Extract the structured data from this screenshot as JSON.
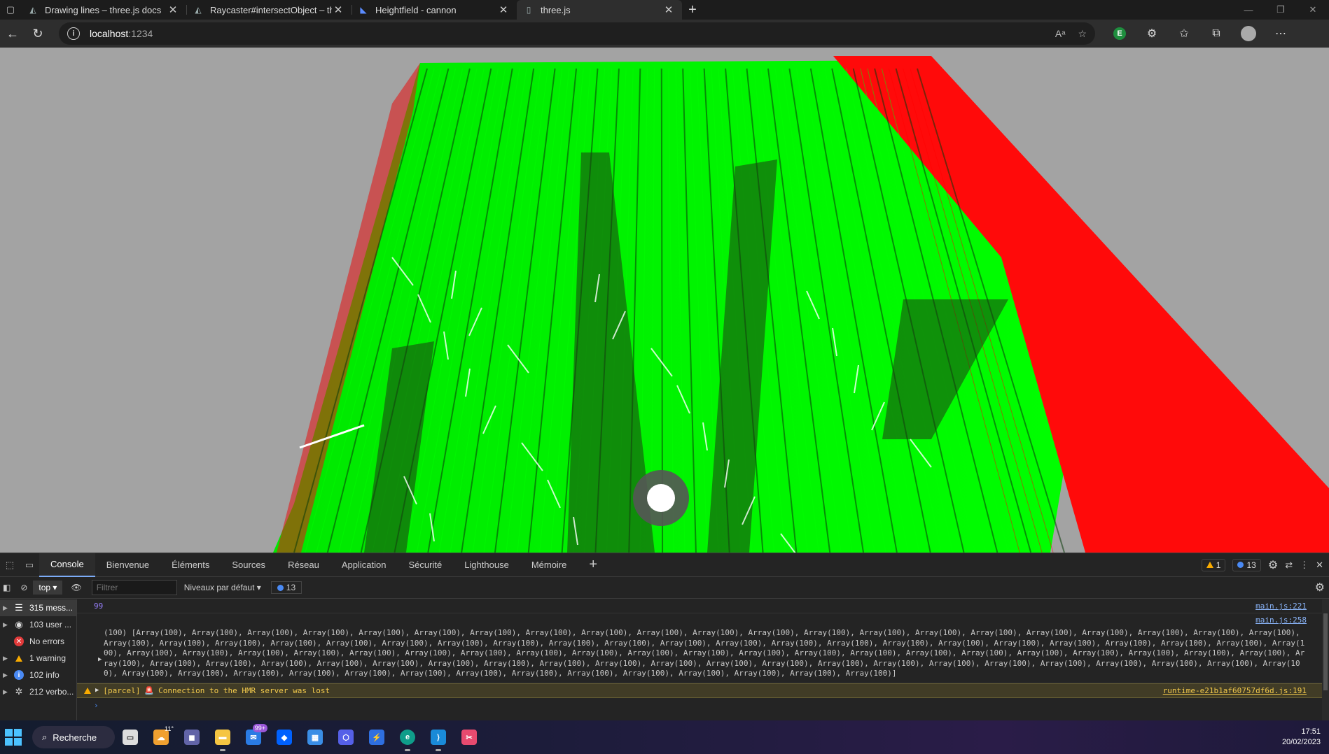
{
  "browser": {
    "tabs": [
      {
        "title": "Drawing lines – three.js docs",
        "icon": "threejs-icon",
        "active": false
      },
      {
        "title": "Raycaster#intersectObject – three.js",
        "icon": "threejs-icon",
        "active": false
      },
      {
        "title": "Heightfield - cannon",
        "icon": "cannon-icon",
        "active": false
      },
      {
        "title": "three.js",
        "icon": "page-icon",
        "active": true
      }
    ],
    "close_glyph": "✕",
    "new_tab_glyph": "+",
    "address": {
      "host": "localhost",
      "port": ":1234"
    }
  },
  "devtools": {
    "tabs": [
      "Console",
      "Bienvenue",
      "Éléments",
      "Sources",
      "Réseau",
      "Application",
      "Sécurité",
      "Lighthouse",
      "Mémoire"
    ],
    "warning_count": "1",
    "info_count": "13",
    "context": "top",
    "filter_placeholder": "Filtrer",
    "levels": "Niveaux par défaut",
    "issues_count": "13",
    "sidebar": [
      {
        "label": "315 mess...",
        "icon": "list-icon"
      },
      {
        "label": "103 user ...",
        "icon": "user-icon"
      },
      {
        "label": "No errors",
        "icon": "error-icon"
      },
      {
        "label": "1 warning",
        "icon": "warning-icon"
      },
      {
        "label": "102 info",
        "icon": "info-icon"
      },
      {
        "label": "212 verbo...",
        "icon": "bug-icon"
      }
    ],
    "logs": {
      "number": {
        "value": "99",
        "source": "main.js:221"
      },
      "array": {
        "source": "main.js:258",
        "text": "(100) [Array(100), Array(100), Array(100), Array(100), Array(100), Array(100), Array(100), Array(100), Array(100), Array(100), Array(100), Array(100), Array(100), Array(100), Array(100), Array(100), Array(100), Array(100), Array(100), Array(100), Array(100), Array(100), Array(100), Array(100), Array(100), Array(100), Array(100), Array(100), Array(100), Array(100), Array(100), Array(100), Array(100), Array(100), Array(100), Array(100), Array(100), Array(100), Array(100), Array(100), Array(100), Array(100), Array(100), Array(100), Array(100), Array(100), Array(100), Array(100), Array(100), Array(100), Array(100), Array(100), Array(100), Array(100), Array(100), Array(100), Array(100), Array(100), Array(100), Array(100), Array(100), Array(100), Array(100), Array(100), Array(100), Array(100), Array(100), Array(100), Array(100), Array(100), Array(100), Array(100), Array(100), Array(100), Array(100), Array(100), Array(100), Array(100), Array(100), Array(100), Array(100), Array(100), Array(100), Array(100), Array(100), Array(100), Array(100), Array(100), Array(100), Array(100), Array(100), Array(100), Array(100), Array(100), Array(100), Array(100), Array(100), Array(100), Array(100), Array(100)]"
      },
      "warning": {
        "prefix": "[parcel]",
        "icon": "🚨",
        "text": "Connection to the HMR server was lost",
        "source": "runtime-e21b1af60757df6d.js:191"
      }
    },
    "prompt": "›"
  },
  "taskbar": {
    "search_label": "Recherche",
    "weather_temp": "11°",
    "mail_badge": "99+",
    "time": "17:51",
    "date": "20/02/2023"
  },
  "colors": {
    "hit": "#00ff00",
    "miss": "#ff0000",
    "background": "#a3a3a3"
  }
}
